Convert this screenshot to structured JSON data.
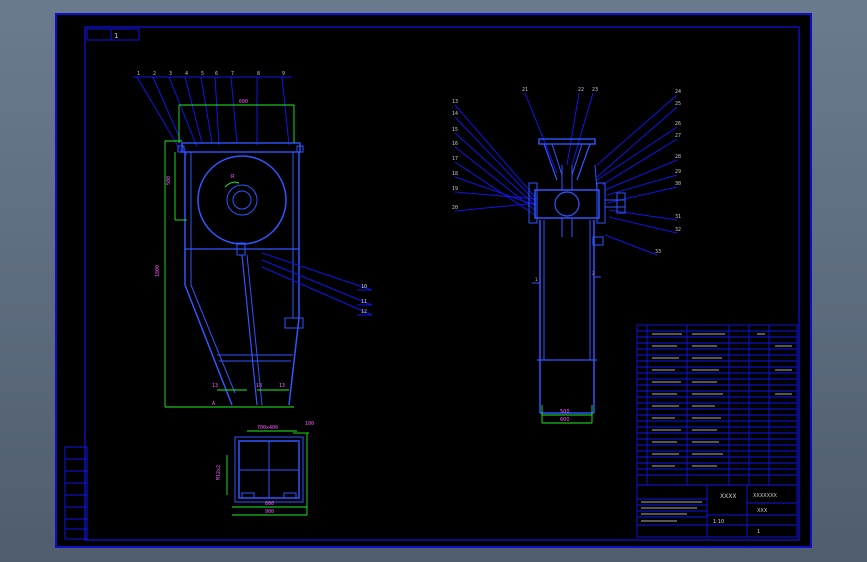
{
  "drawing": {
    "type": "cad-assembly",
    "background": "#000000",
    "frame_color": "#1414e6",
    "dim_color": "#22ee22",
    "accent_color": "#ff00ff",
    "top_tag": "1"
  },
  "title_block": {
    "company": "XXXX",
    "title": "XXXXXXX",
    "drawing_no": "XXX",
    "scale": "1:10",
    "sheet": "1"
  }
}
